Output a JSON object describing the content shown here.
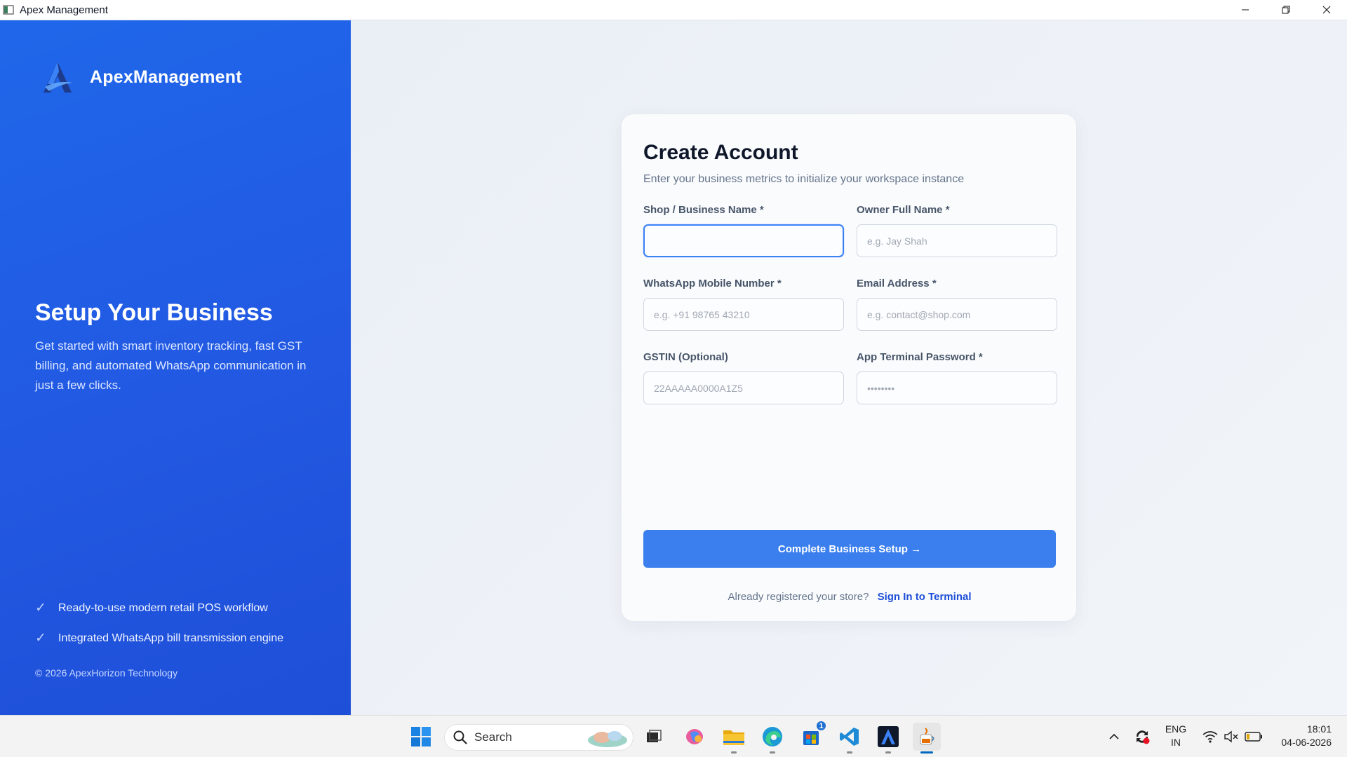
{
  "window": {
    "title": "Apex Management",
    "controls": [
      "minimize-icon",
      "restore-icon",
      "close-icon"
    ]
  },
  "sidebar": {
    "brand_name": "ApexManagement",
    "hero_title": "Setup Your Business",
    "hero_text": "Get started with smart inventory tracking, fast GST billing, and automated WhatsApp communication in just a few clicks.",
    "features": [
      "Ready-to-use modern retail POS workflow",
      "Integrated WhatsApp bill transmission engine"
    ],
    "copyright": "© 2026 ApexHorizon Technology",
    "accent_color": "#2258e2"
  },
  "form": {
    "title": "Create Account",
    "subtitle": "Enter your business metrics to initialize your workspace instance",
    "fields": {
      "shop_name": {
        "label": "Shop / Business Name *",
        "placeholder": "",
        "value": ""
      },
      "owner_name": {
        "label": "Owner Full Name *",
        "placeholder": "e.g. Jay Shah",
        "value": ""
      },
      "whatsapp": {
        "label": "WhatsApp Mobile Number *",
        "placeholder": "e.g. +91 98765 43210",
        "value": ""
      },
      "email": {
        "label": "Email Address *",
        "placeholder": "e.g. contact@shop.com",
        "value": ""
      },
      "gstin": {
        "label": "GSTIN (Optional)",
        "placeholder": "22AAAAA0000A1Z5",
        "value": ""
      },
      "password": {
        "label": "App Terminal Password *",
        "placeholder": "••••••••",
        "value": ""
      }
    },
    "submit_label": "Complete Business Setup  →",
    "signin_prompt": "Already registered your store?",
    "signin_link": "Sign In to Terminal",
    "button_color": "#3b7fee"
  },
  "taskbar": {
    "search_label": "Search",
    "notification_badge": "1",
    "language": {
      "line1": "ENG",
      "line2": "IN"
    },
    "time": "18:01",
    "date": "04-06-2026"
  }
}
